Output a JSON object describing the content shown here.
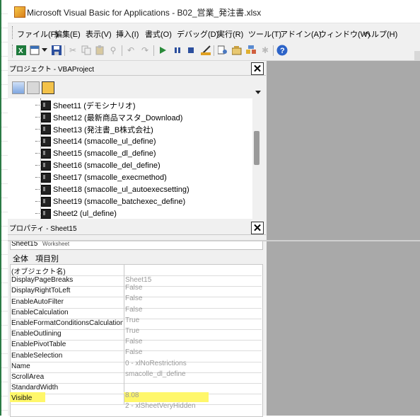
{
  "window": {
    "title": "Microsoft Visual Basic for Applications - B02_営業_発注書.xlsx"
  },
  "menu": [
    "ファイル(F)",
    "編集(E)",
    "表示(V)",
    "挿入(I)",
    "書式(O)",
    "デバッグ(D)",
    "実行(R)",
    "ツール(T)",
    "アドイン(A)",
    "ウィンドウ(W)",
    "ヘルプ(H)"
  ],
  "toolbar_icons": [
    "excel-icon",
    "insert-module-icon",
    "dropdown-arrow-icon",
    "save-icon",
    "cut-icon",
    "copy-icon",
    "paste-icon",
    "find-icon",
    "undo-icon",
    "redo-icon",
    "run-icon",
    "break-icon",
    "reset-icon",
    "design-mode-icon",
    "project-explorer-icon",
    "properties-icon",
    "object-browser-icon",
    "toolbox-icon",
    "help-icon"
  ],
  "project_pane": {
    "title": "プロジェクト - VBAProject",
    "items": [
      "Sheet11 (デモシナリオ)",
      "Sheet12 (最新商品マスタ_Download)",
      "Sheet13 (発注書_B株式会社)",
      "Sheet14 (smacolle_ul_define)",
      "Sheet15 (smacolle_dl_define)",
      "Sheet16 (smacolle_del_define)",
      "Sheet17 (smacolle_execmethod)",
      "Sheet18 (smacolle_ul_autoexecsetting)",
      "Sheet19 (smacolle_batchexec_define)",
      "Sheet2 (ul_define)"
    ]
  },
  "properties_pane": {
    "title": "プロパティ - Sheet15",
    "object_selector": "Sheet15",
    "object_type": "Worksheet",
    "tabs": [
      "全体",
      "項目別"
    ],
    "rows": [
      {
        "name": "(オブジェクト名)",
        "value": "Sheet15"
      },
      {
        "name": "DisplayPageBreaks",
        "value": "False"
      },
      {
        "name": "DisplayRightToLeft",
        "value": "False"
      },
      {
        "name": "EnableAutoFilter",
        "value": "False"
      },
      {
        "name": "EnableCalculation",
        "value": "True"
      },
      {
        "name": "EnableFormatConditionsCalculation",
        "value": "True"
      },
      {
        "name": "EnableOutlining",
        "value": "False"
      },
      {
        "name": "EnablePivotTable",
        "value": "False"
      },
      {
        "name": "EnableSelection",
        "value": "0 - xlNoRestrictions"
      },
      {
        "name": "Name",
        "value": "smacolle_dl_define"
      },
      {
        "name": "ScrollArea",
        "value": ""
      },
      {
        "name": "StandardWidth",
        "value": "8.08"
      },
      {
        "name": "Visible",
        "value": "2 - xlSheetVeryHidden"
      }
    ],
    "highlight_color": "#fff76a"
  }
}
